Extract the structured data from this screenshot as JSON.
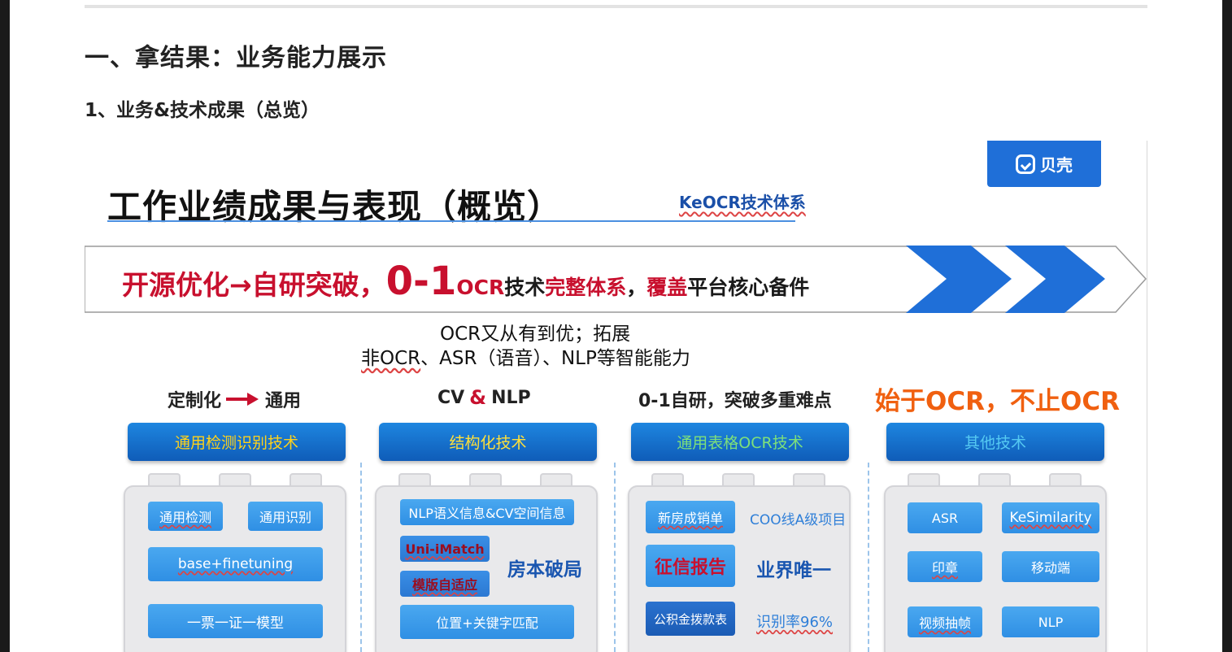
{
  "doc": {
    "heading1": "一、拿结果：业务能力展示",
    "heading2": "1、业务&技术成果（总览）"
  },
  "slide": {
    "logo_text": "贝壳",
    "title": "工作业绩成果与表现（概览）",
    "keocr": "KeOCR技术体系",
    "banner": {
      "part1": "开源优化→自研突破，",
      "part2": "0-1",
      "part3": "OCR",
      "part4": "技术",
      "part5": "完整体系",
      "part6": "，",
      "part7": "覆盖",
      "part8": "平台核心备件"
    },
    "sub_line1": "OCR又从有到优；拓展",
    "sub_line2_a": "非OCR",
    "sub_line2_b": "、ASR（语音）、NLP等智能能力",
    "columns": [
      {
        "head_a": "定制化",
        "head_b": "通用",
        "tech": "通用检测识别技术",
        "chips": [
          "通用检测",
          "通用识别",
          "base+finetuning",
          "一票一证一模型"
        ]
      },
      {
        "head_a": "CV",
        "head_amp": "&",
        "head_b": "NLP",
        "tech": "结构化技术",
        "chips": [
          "NLP语义信息&CV空间信息",
          "Uni-iMatch",
          "模版自适应",
          "房本破局",
          "位置+关键字匹配"
        ]
      },
      {
        "head": "0-1自研，突破多重难点",
        "tech": "通用表格OCR技术",
        "chips": [
          "新房成销单",
          "COO线A级项目",
          "征信报告",
          "业界唯一",
          "公积金拨款表",
          "识别率96%"
        ]
      },
      {
        "head": "始于OCR，不止OCR",
        "tech": "其他技术",
        "chips": [
          "ASR",
          "KeSimilarity",
          "印章",
          "移动端",
          "视频抽帧",
          "NLP"
        ]
      }
    ]
  }
}
